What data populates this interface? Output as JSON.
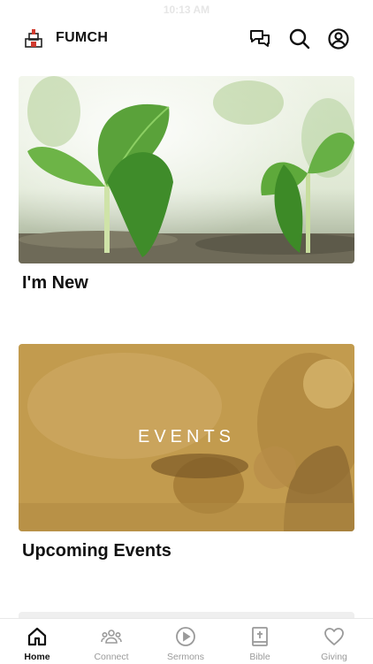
{
  "status_bar": {
    "time": "10:13 AM"
  },
  "header": {
    "app_name": "FUMCH",
    "logo_icon": "church-logo-icon",
    "actions": [
      {
        "icon": "messages-icon"
      },
      {
        "icon": "search-icon"
      },
      {
        "icon": "account-icon"
      }
    ]
  },
  "cards": [
    {
      "title": "I'm New",
      "image": "seedlings-photo"
    },
    {
      "title": "Upcoming Events",
      "image": "events-photo",
      "overlay_text": "EVENTS"
    }
  ],
  "tabs": [
    {
      "label": "Home",
      "icon": "home-icon",
      "active": true
    },
    {
      "label": "Connect",
      "icon": "people-group-icon",
      "active": false
    },
    {
      "label": "Sermons",
      "icon": "play-circle-icon",
      "active": false
    },
    {
      "label": "Bible",
      "icon": "bible-icon",
      "active": false
    },
    {
      "label": "Giving",
      "icon": "heart-icon",
      "active": false
    }
  ],
  "colors": {
    "active_tab": "#111111",
    "inactive_tab": "#9a9a9a",
    "events_tint": "#b78f3e",
    "logo_red": "#d13a2e"
  }
}
